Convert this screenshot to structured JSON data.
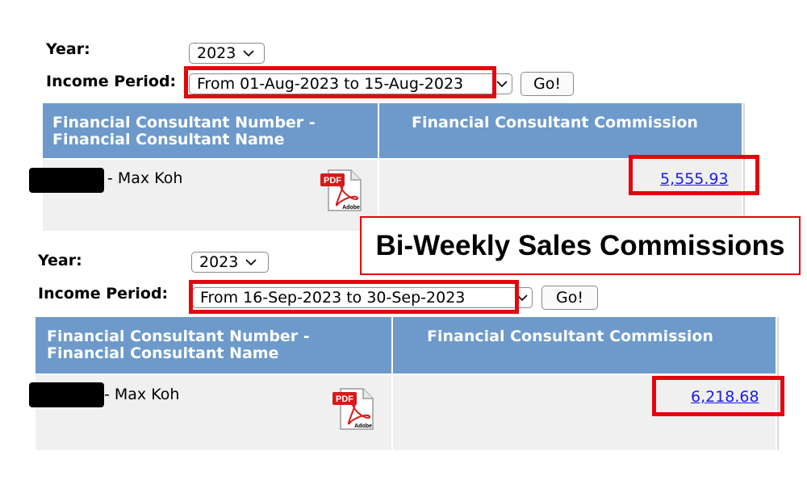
{
  "panels": [
    {
      "year_label": "Year:",
      "year_value": "2023",
      "period_label": "Income Period:",
      "period_value": "From 01-Aug-2023 to 15-Aug-2023",
      "go_label": "Go!",
      "col1_header": "Financial Consultant Number - Financial Consultant Name",
      "col2_header": "Financial Consultant Commission",
      "consultant_name": "- Max Koh",
      "commission": "5,555.93",
      "pdf_icon": "pdf-icon"
    },
    {
      "year_label": "Year:",
      "year_value": "2023",
      "period_label": "Income Period:",
      "period_value": "From 16-Sep-2023 to 30-Sep-2023",
      "go_label": "Go!",
      "col1_header": "Financial Consultant Number - Financial Consultant Name",
      "col2_header": "Financial Consultant Commission",
      "consultant_name": "- Max Koh",
      "commission": "6,218.68",
      "pdf_icon": "pdf-icon"
    }
  ],
  "callout": "Bi-Weekly Sales Commissions",
  "colors": {
    "header_bg": "#6d9acb",
    "highlight_red": "#e3060e",
    "link_blue": "#1a1aee",
    "row_bg": "#f0f0f0"
  }
}
